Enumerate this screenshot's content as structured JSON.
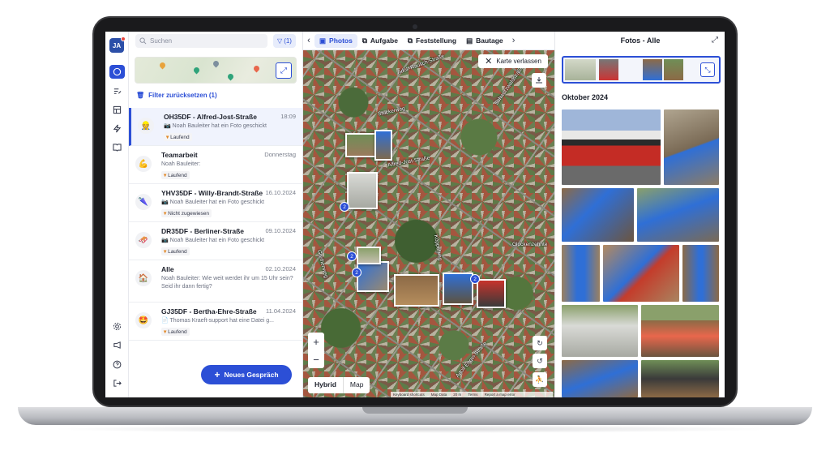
{
  "rail": {
    "avatar_initials": "JA"
  },
  "search": {
    "placeholder": "Suchen",
    "filter_label": "(1)"
  },
  "filter_reset": "Filter zurücksetzen (1)",
  "conversations": [
    {
      "name": "OH35DF - Alfred-Jost-Straße",
      "time": "18:09",
      "message": "📷 Noah Bauleiter hat ein Foto geschickt",
      "status": "Laufend",
      "icon": "👷"
    },
    {
      "name": "Teamarbeit",
      "time": "Donnerstag",
      "message": "Noah Bauleiter:",
      "status": "Laufend",
      "icon": "💪"
    },
    {
      "name": "YHV35DF - Willy-Brandt-Straße",
      "time": "16.10.2024",
      "message": "📷 Noah Bauleiter hat ein Foto geschickt",
      "status": "Nicht zugewiesen",
      "icon": "🌂"
    },
    {
      "name": "DR35DF - Berliner-Straße",
      "time": "09.10.2024",
      "message": "📷 Noah Bauleiter hat ein Foto geschickt",
      "status": "Laufend",
      "icon": "🛷"
    },
    {
      "name": "Alle",
      "time": "02.10.2024",
      "message": "Noah Bauleiter: Wie weit werdet ihr um 15 Uhr sein? Seid ihr dann fertig?",
      "status": "",
      "icon": "🏠"
    },
    {
      "name": "GJ35DF - Bertha-Ehre-Straße",
      "time": "11.04.2024",
      "message": "📄 Thomas Kraeft-support hat eine Datei g...",
      "status": "Laufend",
      "icon": "🤩"
    }
  ],
  "new_chat": "Neues Gespräch",
  "tabs": [
    {
      "label": "Photos",
      "icon": "image-icon",
      "active": true
    },
    {
      "label": "Aufgabe",
      "icon": "copy-icon",
      "active": false
    },
    {
      "label": "Feststellung",
      "icon": "copy-icon",
      "active": false
    },
    {
      "label": "Bautage",
      "icon": "document-icon",
      "active": false
    }
  ],
  "map": {
    "exit_label": "Karte verlassen",
    "streets": [
      "Adolf-Rausch-Straße",
      "Stückerweg",
      "Alfred-Jost-Straße",
      "Schwarzwaldstraße",
      "Koppelweg",
      "Glockenzehnte",
      "Grethenweg",
      "Adolf-Engel-Straße"
    ],
    "cluster_counts": [
      "2",
      "2",
      "2",
      "2"
    ],
    "map_types": [
      "Hybrid",
      "Map"
    ],
    "attribution": [
      "Keyboard shortcuts",
      "Map Data",
      "20 m",
      "Terms",
      "Report a map error"
    ]
  },
  "photos_panel": {
    "title": "Fotos - Alle",
    "month": "Oktober 2024"
  },
  "colors": {
    "accent": "#2c4fd6",
    "status_running": "#e28a2b"
  }
}
